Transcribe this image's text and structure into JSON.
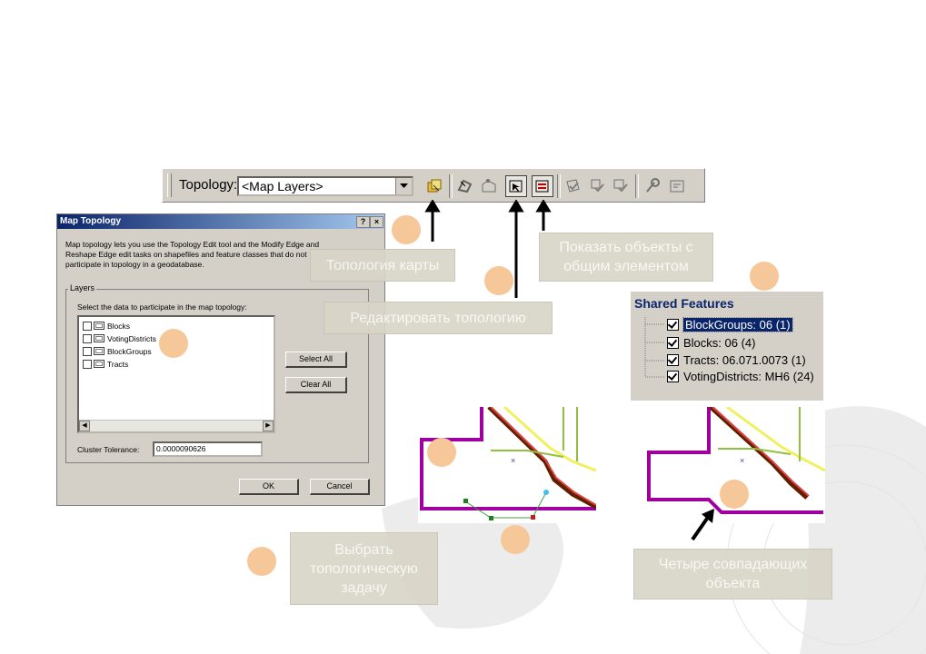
{
  "toolbar": {
    "label": "Topology:",
    "combo_value": "<Map Layers>",
    "buttons": [
      "map-topology-icon",
      "topology-edit-tool-icon",
      "modify-edge-icon",
      "show-shared-features-icon",
      "shared-features-icon",
      "validate-icon",
      "validate-selection-icon",
      "validate-extent-icon",
      "fix-topology-error-icon",
      "error-inspector-icon"
    ]
  },
  "dialog": {
    "title": "Map Topology",
    "help": "?",
    "close": "×",
    "description": "Map topology lets you use the Topology Edit tool and the Modify Edge and Reshape Edge edit tasks on shapefiles and feature classes that do not participate in topology in a geodatabase.",
    "group_title": "Layers",
    "instruction": "Select the data to participate in the map topology:",
    "layers": [
      "Blocks",
      "VotingDistricts",
      "BlockGroups",
      "Tracts"
    ],
    "select_all": "Select All",
    "clear_all": "Clear All",
    "cluster_label": "Cluster Tolerance:",
    "cluster_value": "0.0000090626",
    "ok": "OK",
    "cancel": "Cancel"
  },
  "callouts": {
    "map_topology": "Топология карты",
    "show_shared": "Показать объекты с общим элементом",
    "edit_topology": "Редактировать топологию",
    "select_task": "Выбрать топологическую задачу",
    "four_features": "Четыре совпадающих объекта"
  },
  "shared_features": {
    "title": "Shared Features",
    "items": [
      "BlockGroups: 06 (1)",
      "Blocks: 06 (4)",
      "Tracts: 06.071.0073 (1)",
      "VotingDistricts: MH6 (24)"
    ]
  },
  "colors": {
    "callout_bg": "#d9d6c8",
    "dot": "#f6c799",
    "title_bar": "#0a246a",
    "outline": "#a000a0"
  }
}
